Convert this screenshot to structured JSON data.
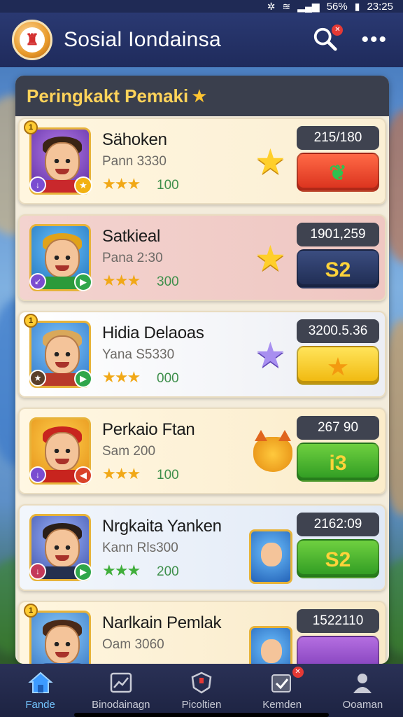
{
  "status": {
    "battery": "56%",
    "time": "23:25"
  },
  "app": {
    "title": "Sosial Iondainsa"
  },
  "leaderboard": {
    "title": "Peringkakt Pemaki",
    "rows": [
      {
        "name": "Sähoken",
        "sub": "Pann 3330",
        "stars": "★★★",
        "points": "100",
        "score": "215/180",
        "button": ""
      },
      {
        "name": "Satkieal",
        "sub": "Pana 2:30",
        "stars": "★★★",
        "points": "300",
        "score": "1901,259",
        "button": "S2"
      },
      {
        "name": "Hidia Delaoas",
        "sub": "Yana S5330",
        "stars": "★★★",
        "points": "000",
        "score": "3200.5.36",
        "button": ""
      },
      {
        "name": "Perkaio Ftan",
        "sub": "Sam 200",
        "stars": "★★★",
        "points": "100",
        "score": "267 90",
        "button": "i3"
      },
      {
        "name": "Nrgkaita Yanken",
        "sub": "Kann Rls300",
        "stars": "★★★",
        "points": "200",
        "score": "2162:09",
        "button": "S2"
      },
      {
        "name": "Narlkain Pemlak",
        "sub": "Oam 3060",
        "stars": "★★★",
        "points": "",
        "score": "1522110",
        "button": ""
      }
    ]
  },
  "nav": {
    "items": [
      {
        "label": "Fande"
      },
      {
        "label": "Binodainagn"
      },
      {
        "label": "Picoltien"
      },
      {
        "label": "Kemden"
      },
      {
        "label": "Ooaman"
      }
    ]
  },
  "colors": {
    "appbar": "#1f2b5c",
    "panel_header": "#3a3f4d",
    "title_gold": "#ffd35a",
    "nav_active": "#74c5ff"
  }
}
